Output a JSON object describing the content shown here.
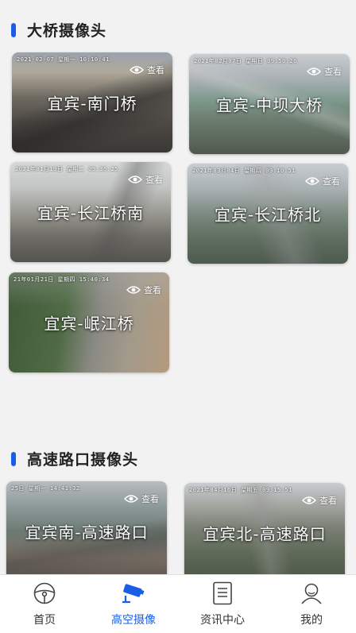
{
  "sections": {
    "bridges": {
      "title": "大桥摄像头"
    },
    "highway": {
      "title": "高速路口摄像头"
    }
  },
  "view_label": "查看",
  "bridge_cams": [
    {
      "name": "宜宾-南门桥",
      "stamp": "2021-02-07 星期一 10:10:41"
    },
    {
      "name": "宜宾-中坝大桥",
      "stamp": "2021年02月07日 星期日 09:50:26"
    },
    {
      "name": "宜宾-长江桥南",
      "stamp": "2021年01月19日 星期二 09:36:25"
    },
    {
      "name": "宜宾-长江桥北",
      "stamp": "2021年03月04日 星期四 09:10:51"
    },
    {
      "name": "宜宾-岷江桥",
      "stamp": "21年01月21日 星期四 15:40:34"
    }
  ],
  "highway_cams": [
    {
      "name": "宜宾南-高速路口",
      "stamp": "25日 星期一 14:41:32"
    },
    {
      "name": "宜宾北-高速路口",
      "stamp": "2021年04月16日 星期五 09:15:51"
    }
  ],
  "tabbar": {
    "items": [
      {
        "label": "首页",
        "icon": "steering-wheel-icon",
        "active": false
      },
      {
        "label": "高空摄像",
        "icon": "cctv-camera-icon",
        "active": true
      },
      {
        "label": "资讯中心",
        "icon": "document-icon",
        "active": false
      },
      {
        "label": "我的",
        "icon": "user-icon",
        "active": false
      }
    ]
  },
  "colors": {
    "accent": "#1a5ee6",
    "background": "#f2f2f2",
    "tab_inactive": "#333333"
  }
}
